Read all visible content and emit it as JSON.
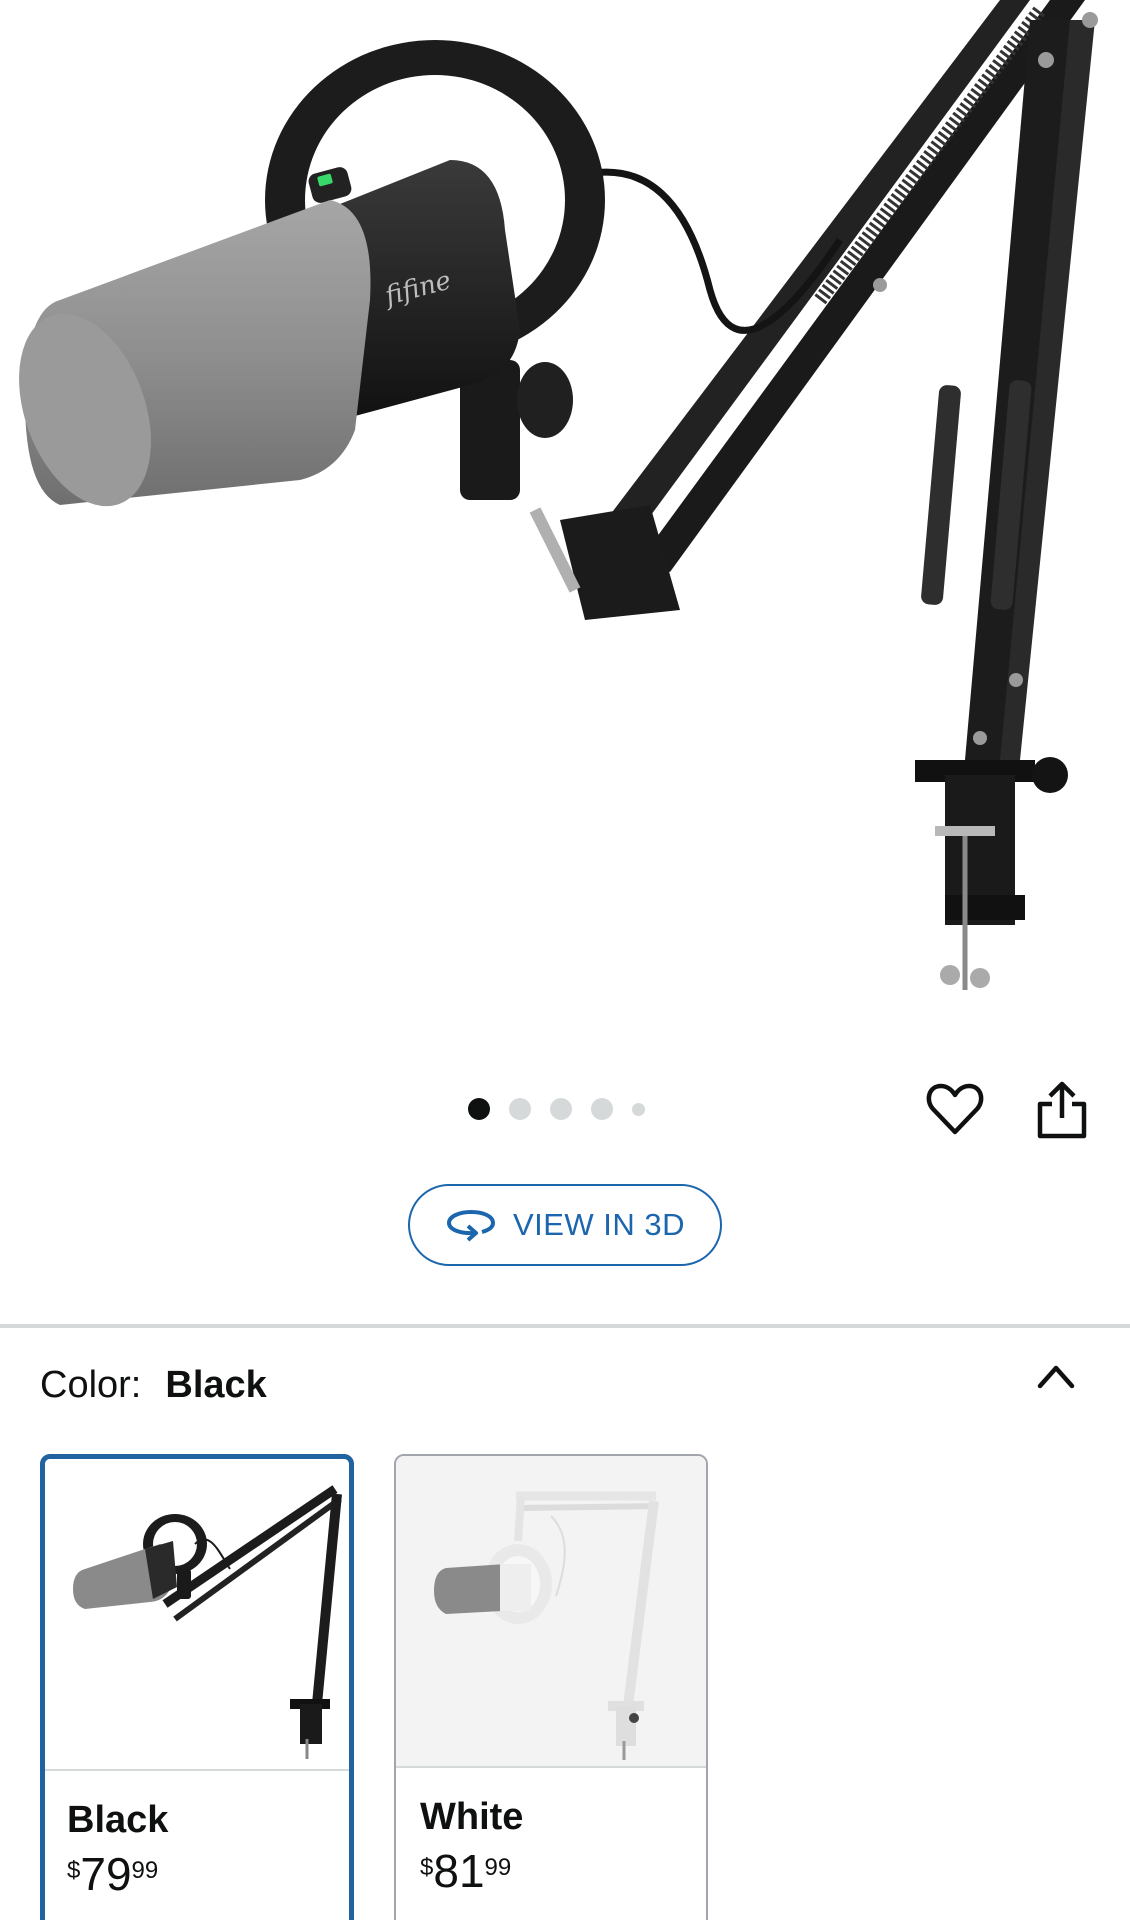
{
  "hero": {
    "image_alt": "fifine microphone on boom arm",
    "brand_mark": "fifine",
    "carousel": {
      "count": 5,
      "active_index": 0
    }
  },
  "actions": {
    "view_3d_label": "VIEW IN 3D",
    "favorite_icon": "heart-icon",
    "share_icon": "share-icon"
  },
  "variation": {
    "label": "Color:",
    "selected": "Black",
    "toggle_icon": "chevron-up-icon",
    "options": [
      {
        "name": "Black",
        "price_symbol": "$",
        "price_whole": "79",
        "price_fraction": "99",
        "selected": true
      },
      {
        "name": "White",
        "price_symbol": "$",
        "price_whole": "81",
        "price_fraction": "99",
        "selected": false
      }
    ]
  },
  "colors": {
    "accent_blue": "#1b66ad",
    "selected_border": "#2162a1",
    "divider": "#d5d9d9"
  }
}
